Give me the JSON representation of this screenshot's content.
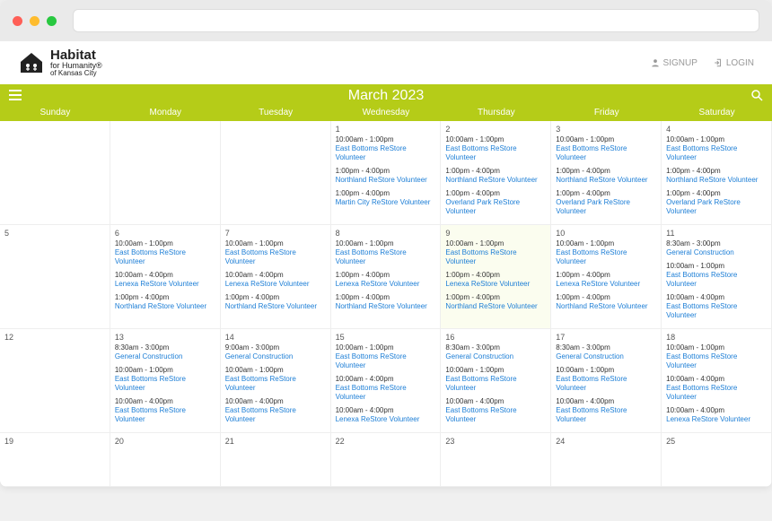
{
  "auth": {
    "signup": "SIGNUP",
    "login": "LOGIN"
  },
  "logo": {
    "line1": "Habitat",
    "line2": "for Humanity®",
    "line3": "of Kansas City"
  },
  "calendar": {
    "title": "March 2023",
    "dow": [
      "Sunday",
      "Monday",
      "Tuesday",
      "Wednesday",
      "Thursday",
      "Friday",
      "Saturday"
    ],
    "weeks": [
      [
        {
          "num": ""
        },
        {
          "num": ""
        },
        {
          "num": ""
        },
        {
          "num": "1",
          "events": [
            {
              "time": "10:00am - 1:00pm",
              "title": "East Bottoms ReStore Volunteer"
            },
            {
              "time": "1:00pm - 4:00pm",
              "title": "Northland ReStore Volunteer"
            },
            {
              "time": "1:00pm - 4:00pm",
              "title": "Martin City ReStore Volunteer"
            }
          ]
        },
        {
          "num": "2",
          "events": [
            {
              "time": "10:00am - 1:00pm",
              "title": "East Bottoms ReStore Volunteer"
            },
            {
              "time": "1:00pm - 4:00pm",
              "title": "Northland ReStore Volunteer"
            },
            {
              "time": "1:00pm - 4:00pm",
              "title": "Overland Park ReStore Volunteer"
            }
          ]
        },
        {
          "num": "3",
          "events": [
            {
              "time": "10:00am - 1:00pm",
              "title": "East Bottoms ReStore Volunteer"
            },
            {
              "time": "1:00pm - 4:00pm",
              "title": "Northland ReStore Volunteer"
            },
            {
              "time": "1:00pm - 4:00pm",
              "title": "Overland Park ReStore Volunteer"
            }
          ]
        },
        {
          "num": "4",
          "events": [
            {
              "time": "10:00am - 1:00pm",
              "title": "East Bottoms ReStore Volunteer"
            },
            {
              "time": "1:00pm - 4:00pm",
              "title": "Northland ReStore Volunteer"
            },
            {
              "time": "1:00pm - 4:00pm",
              "title": "Overland Park ReStore Volunteer"
            }
          ]
        }
      ],
      [
        {
          "num": "5"
        },
        {
          "num": "6",
          "events": [
            {
              "time": "10:00am - 1:00pm",
              "title": "East Bottoms ReStore Volunteer"
            },
            {
              "time": "10:00am - 4:00pm",
              "title": "Lenexa ReStore Volunteer"
            },
            {
              "time": "1:00pm - 4:00pm",
              "title": "Northland ReStore Volunteer"
            }
          ]
        },
        {
          "num": "7",
          "events": [
            {
              "time": "10:00am - 1:00pm",
              "title": "East Bottoms ReStore Volunteer"
            },
            {
              "time": "10:00am - 4:00pm",
              "title": "Lenexa ReStore Volunteer"
            },
            {
              "time": "1:00pm - 4:00pm",
              "title": "Northland ReStore Volunteer"
            }
          ]
        },
        {
          "num": "8",
          "events": [
            {
              "time": "10:00am - 1:00pm",
              "title": "East Bottoms ReStore Volunteer"
            },
            {
              "time": "1:00pm - 4:00pm",
              "title": "Lenexa ReStore Volunteer"
            },
            {
              "time": "1:00pm - 4:00pm",
              "title": "Northland ReStore Volunteer"
            }
          ]
        },
        {
          "num": "9",
          "today": true,
          "events": [
            {
              "time": "10:00am - 1:00pm",
              "title": "East Bottoms ReStore Volunteer"
            },
            {
              "time": "1:00pm - 4:00pm",
              "title": "Lenexa ReStore Volunteer"
            },
            {
              "time": "1:00pm - 4:00pm",
              "title": "Northland ReStore Volunteer"
            }
          ]
        },
        {
          "num": "10",
          "events": [
            {
              "time": "10:00am - 1:00pm",
              "title": "East Bottoms ReStore Volunteer"
            },
            {
              "time": "1:00pm - 4:00pm",
              "title": "Lenexa ReStore Volunteer"
            },
            {
              "time": "1:00pm - 4:00pm",
              "title": "Northland ReStore Volunteer"
            }
          ]
        },
        {
          "num": "11",
          "events": [
            {
              "time": "8:30am - 3:00pm",
              "title": "General Construction"
            },
            {
              "time": "10:00am - 1:00pm",
              "title": "East Bottoms ReStore Volunteer"
            },
            {
              "time": "10:00am - 4:00pm",
              "title": "East Bottoms ReStore Volunteer"
            }
          ]
        }
      ],
      [
        {
          "num": "12"
        },
        {
          "num": "13",
          "events": [
            {
              "time": "8:30am - 3:00pm",
              "title": "General Construction"
            },
            {
              "time": "10:00am - 1:00pm",
              "title": "East Bottoms ReStore Volunteer"
            },
            {
              "time": "10:00am - 4:00pm",
              "title": "East Bottoms ReStore Volunteer"
            }
          ]
        },
        {
          "num": "14",
          "events": [
            {
              "time": "9:00am - 3:00pm",
              "title": "General Construction"
            },
            {
              "time": "10:00am - 1:00pm",
              "title": "East Bottoms ReStore Volunteer"
            },
            {
              "time": "10:00am - 4:00pm",
              "title": "East Bottoms ReStore Volunteer"
            }
          ]
        },
        {
          "num": "15",
          "events": [
            {
              "time": "10:00am - 1:00pm",
              "title": "East Bottoms ReStore Volunteer"
            },
            {
              "time": "10:00am - 4:00pm",
              "title": "East Bottoms ReStore Volunteer"
            },
            {
              "time": "10:00am - 4:00pm",
              "title": "Lenexa ReStore Volunteer"
            }
          ]
        },
        {
          "num": "16",
          "events": [
            {
              "time": "8:30am - 3:00pm",
              "title": "General Construction"
            },
            {
              "time": "10:00am - 1:00pm",
              "title": "East Bottoms ReStore Volunteer"
            },
            {
              "time": "10:00am - 4:00pm",
              "title": "East Bottoms ReStore Volunteer"
            }
          ]
        },
        {
          "num": "17",
          "events": [
            {
              "time": "8:30am - 3:00pm",
              "title": "General Construction"
            },
            {
              "time": "10:00am - 1:00pm",
              "title": "East Bottoms ReStore Volunteer"
            },
            {
              "time": "10:00am - 4:00pm",
              "title": "East Bottoms ReStore Volunteer"
            }
          ]
        },
        {
          "num": "18",
          "events": [
            {
              "time": "10:00am - 1:00pm",
              "title": "East Bottoms ReStore Volunteer"
            },
            {
              "time": "10:00am - 4:00pm",
              "title": "East Bottoms ReStore Volunteer"
            },
            {
              "time": "10:00am - 4:00pm",
              "title": "Lenexa ReStore Volunteer"
            }
          ]
        }
      ],
      [
        {
          "num": "19"
        },
        {
          "num": "20"
        },
        {
          "num": "21"
        },
        {
          "num": "22"
        },
        {
          "num": "23"
        },
        {
          "num": "24"
        },
        {
          "num": "25"
        }
      ]
    ]
  }
}
